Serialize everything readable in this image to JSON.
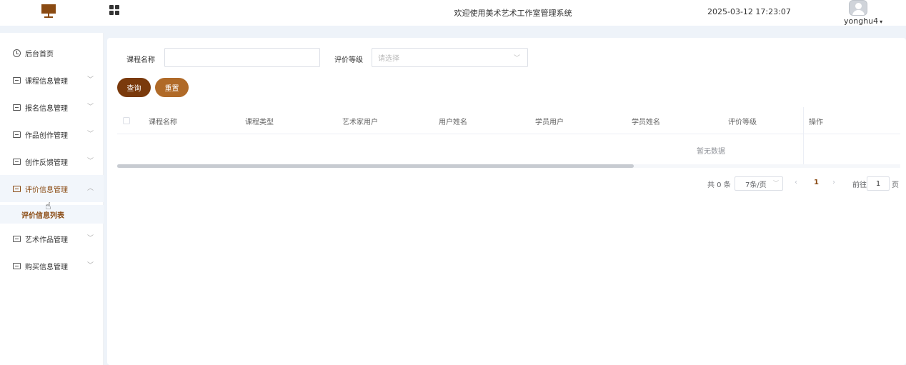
{
  "header": {
    "site_title": "欢迎使用美术艺术工作室管理系统",
    "datetime": "2025-03-12 17:23:07",
    "username": "yonghu4"
  },
  "sidebar": {
    "items": [
      {
        "label": "后台首页",
        "icon": "clock-icon"
      },
      {
        "label": "课程信息管理",
        "icon": "menu-icon"
      },
      {
        "label": "报名信息管理",
        "icon": "menu-icon"
      },
      {
        "label": "作品创作管理",
        "icon": "menu-icon"
      },
      {
        "label": "创作反馈管理",
        "icon": "menu-icon"
      },
      {
        "label": "评价信息管理",
        "icon": "menu-icon",
        "active": true
      },
      {
        "label": "艺术作品管理",
        "icon": "menu-icon"
      },
      {
        "label": "购买信息管理",
        "icon": "menu-icon"
      }
    ],
    "submenu": {
      "label": "评价信息列表"
    }
  },
  "search": {
    "course_label": "课程名称",
    "course_value": "",
    "rating_label": "评价等级",
    "rating_placeholder": "请选择",
    "query_label": "查询",
    "reset_label": "重置"
  },
  "table": {
    "columns": [
      "课程名称",
      "课程类型",
      "艺术家用户",
      "用户姓名",
      "学员用户",
      "学员姓名",
      "评价等级",
      "操作"
    ],
    "empty_text": "暂无数据"
  },
  "pagination": {
    "total_text": "共 0 条",
    "page_size": "7条/页",
    "current_page": "1",
    "goto_label": "前往",
    "goto_value": "1",
    "page_suffix": "页"
  },
  "colors": {
    "accent": "#8a4a12",
    "query_button": "#7a3a0c",
    "reset_button": "#b06a28"
  }
}
